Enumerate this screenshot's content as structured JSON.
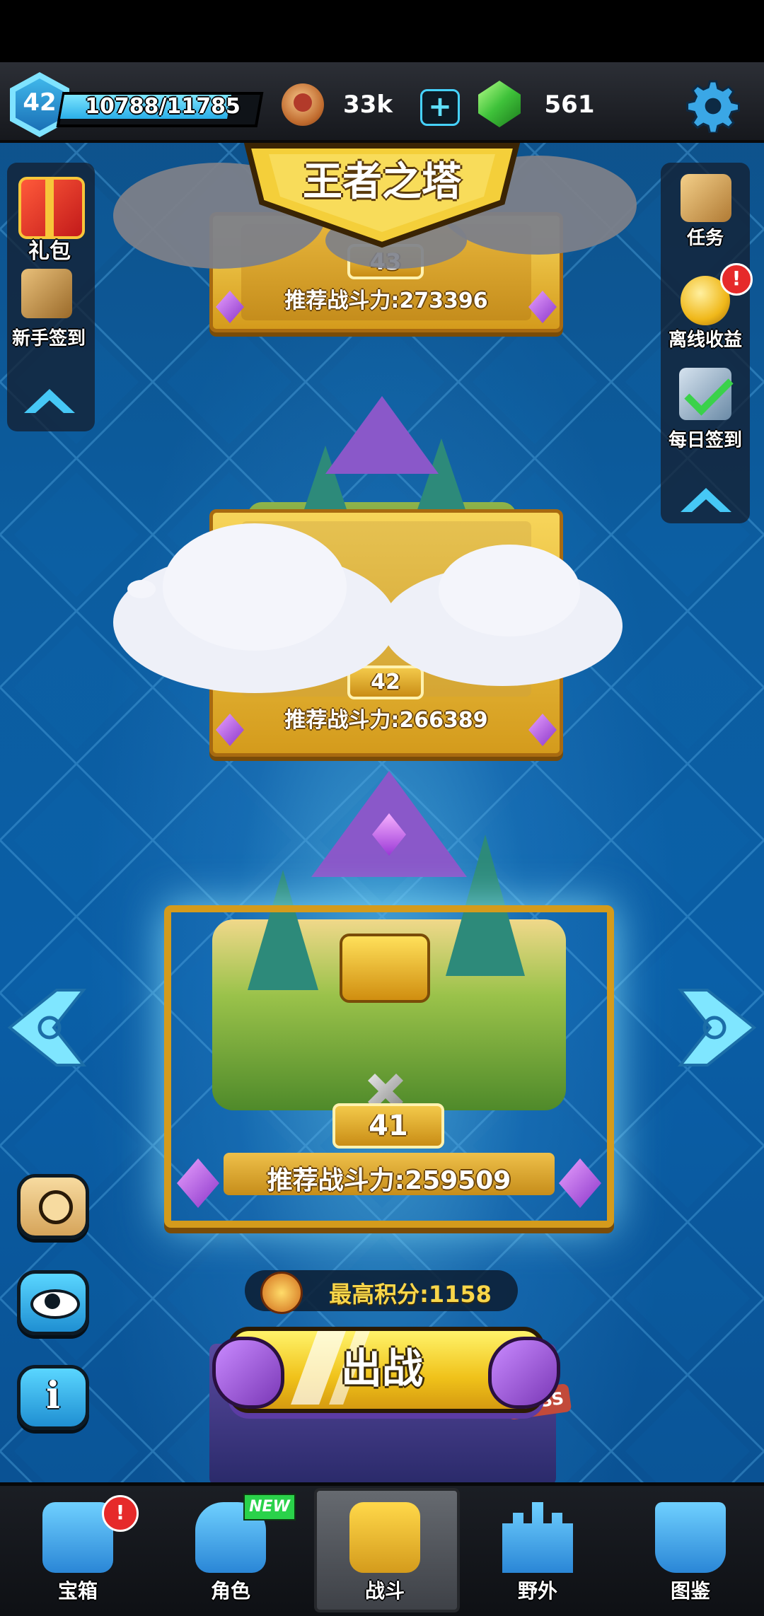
{
  "top_bar": {
    "level": "42",
    "xp_text": "10788/11785",
    "xp_progress": 0.915,
    "coin_value": "33k",
    "gem_value": "561"
  },
  "title": "王者之塔",
  "left_sidebar": {
    "items": [
      {
        "label": "礼包",
        "icon": "gift-icon"
      },
      {
        "label": "新手签到",
        "icon": "scroll-quill-icon"
      }
    ]
  },
  "right_sidebar": {
    "items": [
      {
        "label": "任务",
        "icon": "quest-scroll-icon"
      },
      {
        "label": "离线收益",
        "icon": "gold-coin-icon",
        "badge": "!"
      },
      {
        "label": "每日签到",
        "icon": "checkmark-scroll-icon"
      }
    ]
  },
  "levels": [
    {
      "number": "43",
      "power_text": "推荐战斗力:273396"
    },
    {
      "number": "42",
      "power_text": "推荐战斗力:266389"
    },
    {
      "number": "41",
      "power_text": "推荐战斗力:259509"
    }
  ],
  "score": {
    "text": "最高积分:1158"
  },
  "fight_button": {
    "label": "出战"
  },
  "boss_tag": "BOSS",
  "nav": {
    "items": [
      {
        "label": "宝箱",
        "icon": "chest-icon",
        "badge": "!"
      },
      {
        "label": "角色",
        "icon": "hero-helmet-icon",
        "badge": "NEW"
      },
      {
        "label": "战斗",
        "icon": "crossed-swords-crown-icon",
        "active": true
      },
      {
        "label": "野外",
        "icon": "castle-icon"
      },
      {
        "label": "图鉴",
        "icon": "book-icon"
      }
    ]
  },
  "colors": {
    "accent": "#46d2ff",
    "gold": "#f0c21a",
    "purple": "#8a35c9",
    "badge_red": "#e62a2a"
  }
}
